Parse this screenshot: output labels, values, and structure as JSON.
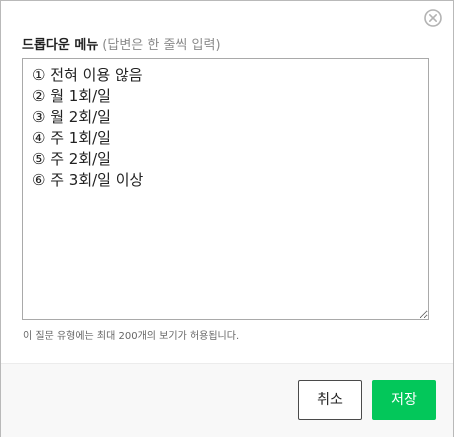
{
  "dialog": {
    "title": "드롭다운 메뉴",
    "title_hint": "(답변은 한 줄씩 입력)",
    "options_text": "① 전혀 이용 않음\n② 월 1회/일\n③ 월 2회/일\n④ 주 1회/일\n⑤ 주 2회/일\n⑥ 주 3회/일 이상",
    "help_text": "이 질문 유형에는 최대 200개의 보기가 허용됩니다.",
    "close_icon": "close-circle-icon"
  },
  "footer": {
    "cancel_label": "취소",
    "save_label": "저장"
  },
  "colors": {
    "save_button": "#03c75a",
    "cancel_border": "#4a4a4a",
    "footer_bg": "#f8f8f8"
  }
}
